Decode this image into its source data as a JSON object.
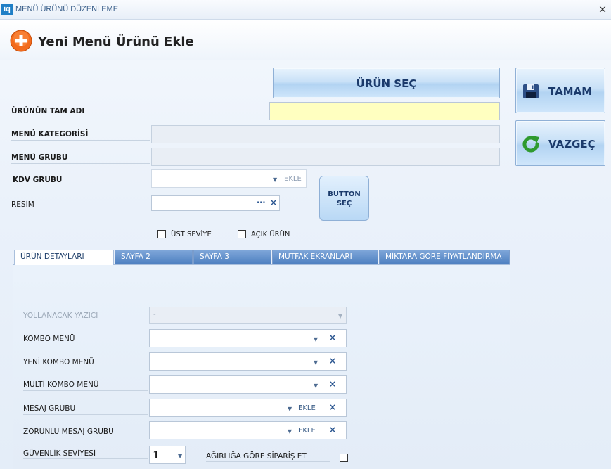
{
  "window": {
    "app_icon_text": "iq",
    "title": "MENÜ ÜRÜNÜ DÜZENLEME",
    "close_glyph": "×"
  },
  "header": {
    "title": "Yeni Menü Ürünü Ekle",
    "icon": "add-circle-icon"
  },
  "actions": {
    "urun_sec": "ÜRÜN SEÇ",
    "tamam": "TAMAM",
    "vazgec": "VAZGEÇ",
    "button_sec_line1": "BUTTON",
    "button_sec_line2": "SEÇ",
    "tamam_icon": "save-disk-icon",
    "vazgec_icon": "refresh-arrow-icon"
  },
  "form": {
    "urunun_tam_adi": {
      "label": "ÜRÜNÜN TAM ADI",
      "value": ""
    },
    "menu_kategorisi": {
      "label": "MENÜ KATEGORİSİ",
      "value": ""
    },
    "menu_grubu": {
      "label": "MENÜ GRUBU",
      "value": ""
    },
    "kdv_grubu": {
      "label": "KDV GRUBU",
      "value": "",
      "ekle": "EKLE"
    },
    "resim": {
      "label": "RESİM",
      "value": "",
      "browse": "···",
      "clear": "×"
    },
    "ust_seviye": {
      "label": "ÜST SEVİYE",
      "checked": false
    },
    "acik_urun": {
      "label": "AÇIK ÜRÜN",
      "checked": false
    }
  },
  "tabs": [
    {
      "label": "ÜRÜN DETAYLARI",
      "active": true
    },
    {
      "label": "SAYFA 2",
      "active": false
    },
    {
      "label": "SAYFA 3",
      "active": false
    },
    {
      "label": "MUTFAK EKRANLARI",
      "active": false
    },
    {
      "label": "MİKTARA GÖRE FİYATLANDIRMA",
      "active": false
    }
  ],
  "details": {
    "yollanacak_yazici": {
      "label": "YOLLANACAK YAZICI",
      "value": "-",
      "disabled": true
    },
    "kombo_menu": {
      "label": "KOMBO MENÜ",
      "value": ""
    },
    "yeni_kombo_menu": {
      "label": "YENİ KOMBO MENÜ",
      "value": ""
    },
    "multi_kombo_menu": {
      "label": "MULTİ KOMBO MENÜ",
      "value": ""
    },
    "mesaj_grubu": {
      "label": "MESAJ GRUBU",
      "value": "",
      "ekle": "EKLE"
    },
    "zorunlu_mesaj_grubu": {
      "label": "ZORUNLU MESAJ GRUBU",
      "value": "",
      "ekle": "EKLE"
    },
    "guvenlik_seviyesi": {
      "label": "GÜVENLİK SEVİYESİ",
      "value": "1"
    },
    "agirliga_gore": {
      "label": "AĞIRLIĞA GÖRE SİPARİŞ ET",
      "checked": false
    }
  },
  "glyphs": {
    "dropdown": "▼",
    "clear": "×"
  },
  "colors": {
    "accent": "#1b3a6b",
    "tab_blue": "#4d7fc0",
    "input_highlight": "#ffffc0",
    "plus_orange": "#f26b1d"
  }
}
